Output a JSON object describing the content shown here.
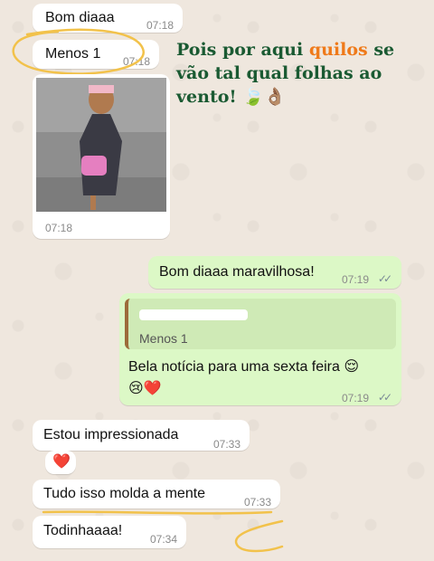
{
  "messages": {
    "m1": {
      "text": "Bom diaaa",
      "time": "07:18"
    },
    "m2": {
      "text": "Menos 1",
      "time": "07:18"
    },
    "m3": {
      "time": "07:18"
    },
    "m4": {
      "text": "Bom diaaa maravilhosa!",
      "time": "07:19"
    },
    "m5": {
      "quote_text": "Menos 1",
      "text": "Bela notícia para uma sexta feira 😌",
      "text2": "😢❤️",
      "time": "07:19"
    },
    "m6": {
      "text": "Estou impressionada",
      "time": "07:33"
    },
    "m7": {
      "text": "❤️"
    },
    "m8": {
      "text": "Tudo isso molda a mente",
      "time": "07:33"
    },
    "m9": {
      "text": "Todinhaaaa!",
      "time": "07:34"
    }
  },
  "promo": {
    "part1": "Pois por aqui ",
    "highlight": "quilos",
    "part2": " se vão tal qual folhas ao vento! 🍃👌🏽"
  },
  "colors": {
    "incoming": "#ffffff",
    "outgoing": "#dcf8c6",
    "wallpaper": "#efe7de",
    "brand_green": "#1a5a32",
    "brand_orange": "#ef7a1a",
    "annotation": "#f2c24b"
  }
}
